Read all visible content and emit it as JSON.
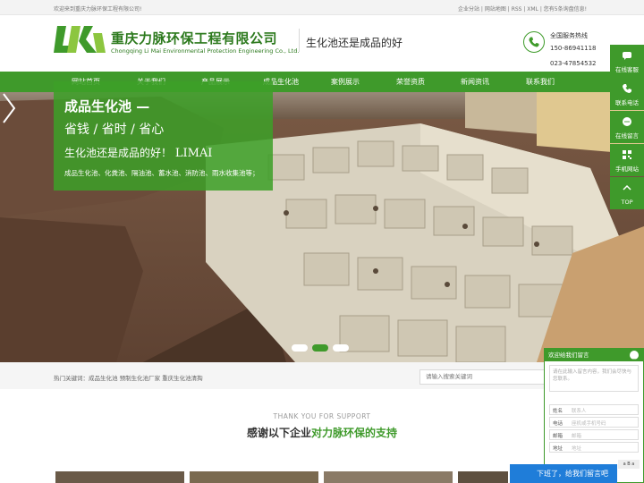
{
  "topbar": {
    "welcome": "欢迎来到重庆力脉环保工程有限公司!",
    "links": "企业分站 | 网站地图 | RSS | XML | 您有5条询盘信息!"
  },
  "header": {
    "company_cn": "重庆力脉环保工程有限公司",
    "company_en": "Chongqing Li Mai Environmental Protection Engineering Co., Ltd.",
    "slogan": "生化池还是成品的好",
    "hotline_label": "全国服务热线",
    "hotline_1": "150-86941118",
    "hotline_2": "023-47854532",
    "brand_color": "#3f9a2b"
  },
  "nav": {
    "items": [
      "网站首页",
      "关于我们",
      "产品展示",
      "成品生化池",
      "案例展示",
      "荣誉资质",
      "新闻资讯",
      "联系我们"
    ]
  },
  "hero": {
    "title": "成品生化池 —",
    "subtitle": "省钱 / 省时 / 省心",
    "line3_cn": "生化池还是成品的好！",
    "line3_en": "LIMAI",
    "tags": "成品生化池、化粪池、隔油池、蓄水池、消防池、雨水收集池等；"
  },
  "keywords": {
    "label": "热门关键词：成品生化池  预制生化池厂家  重庆生化池清掏",
    "search_placeholder": "请输入搜索关键词"
  },
  "thanks": {
    "en": "THANK YOU FOR SUPPORT",
    "cn_prefix": "感谢以下企业",
    "cn_highlight": "对力脉环保的支持"
  },
  "float_bar": {
    "items": [
      "在线客服",
      "联系电话",
      "在线留言",
      "手机网站",
      "TOP"
    ]
  },
  "message": {
    "title": "欢迎给我们留言",
    "placeholder": "请在此输入留言内容，我们会尽快与您联系。",
    "fields": [
      {
        "label": "姓名",
        "placeholder": "联系人"
      },
      {
        "label": "电话",
        "placeholder": "座机或手机号码"
      },
      {
        "label": "邮箱",
        "placeholder": "邮箱"
      },
      {
        "label": "地址",
        "placeholder": "地址"
      }
    ],
    "captcha": "a B a",
    "leave_button": "下班了，给我们留言吧"
  }
}
